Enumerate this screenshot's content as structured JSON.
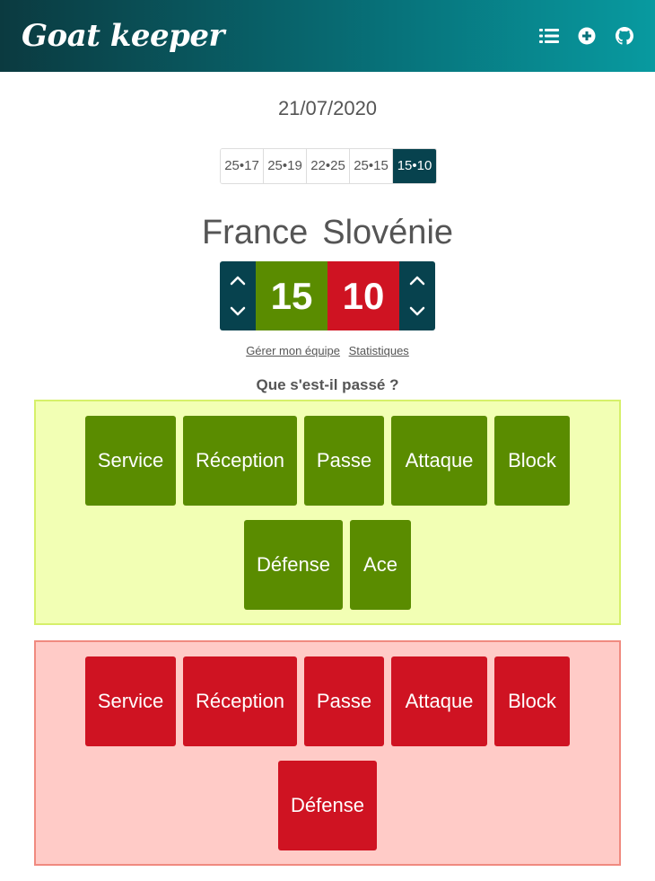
{
  "app": {
    "title": "Goat keeper"
  },
  "nav": {
    "icons": [
      "list-icon",
      "add-circle-icon",
      "github-icon"
    ]
  },
  "match": {
    "date": "21/07/2020",
    "sets": [
      {
        "label": "25•17",
        "active": false
      },
      {
        "label": "25•19",
        "active": false
      },
      {
        "label": "22•25",
        "active": false
      },
      {
        "label": "25•15",
        "active": false
      },
      {
        "label": "15•10",
        "active": true
      }
    ],
    "home_team": "France",
    "away_team": "Slovénie",
    "home_score": "15",
    "away_score": "10"
  },
  "links": {
    "manage_team": "Gérer mon équipe",
    "statistics": "Statistiques"
  },
  "question": "Que s'est-il passé ?",
  "home_actions": [
    "Service",
    "Réception",
    "Passe",
    "Attaque",
    "Block",
    "Défense",
    "Ace"
  ],
  "away_actions": [
    "Service",
    "Réception",
    "Passe",
    "Attaque",
    "Block",
    "Défense"
  ],
  "colors": {
    "home": "#5a8c00",
    "away": "#cf1322",
    "accent": "#07424e"
  }
}
